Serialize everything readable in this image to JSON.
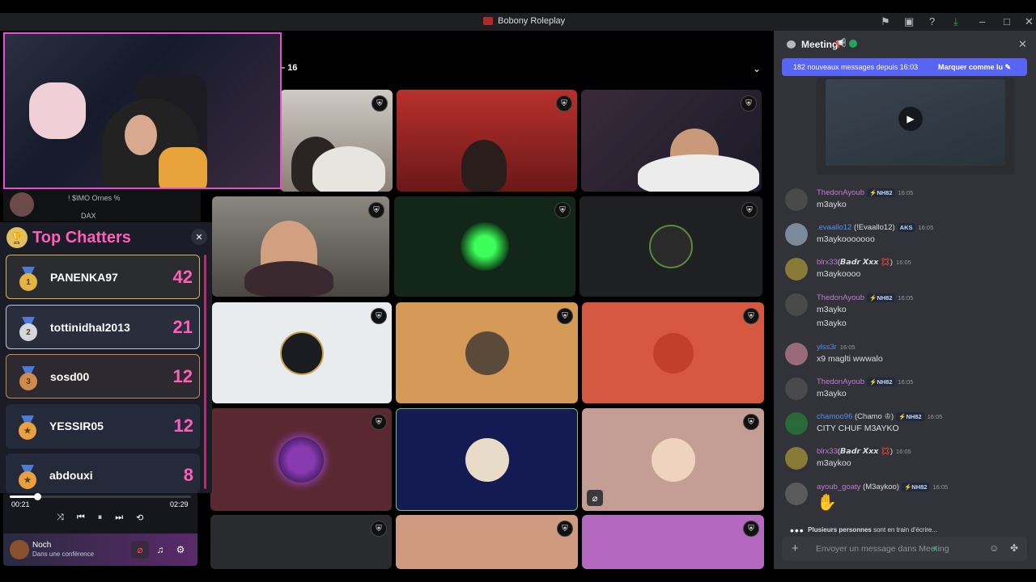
{
  "window": {
    "title": "Bobony Roleplay"
  },
  "stage": {
    "count_label": "16"
  },
  "left": {
    "user_rows": [
      {
        "text": "! $IMO Ornes %"
      },
      {
        "text": "DAX"
      }
    ],
    "top_chatters": {
      "title": "Top Chatters",
      "close": "✕",
      "entries": [
        {
          "rank": "1",
          "name": "PANENKA97",
          "count": "42",
          "coin": "#e3b344",
          "ribbon": "#4c7ad8"
        },
        {
          "rank": "2",
          "name": "tottinidhal2013",
          "count": "21",
          "coin": "#d4d6e0",
          "ribbon": "#4c7ad8"
        },
        {
          "rank": "3",
          "name": "sosd00",
          "count": "12",
          "coin": "#cf8a4e",
          "ribbon": "#4c7ad8"
        },
        {
          "rank": "★",
          "name": "YESSIR05",
          "count": "12",
          "coin": "#e8a040",
          "ribbon": "#4c7ad8"
        },
        {
          "rank": "★",
          "name": "abdouxi",
          "count": "8",
          "coin": "#e8a040",
          "ribbon": "#4c7ad8"
        }
      ]
    },
    "player": {
      "elapsed": "00:21",
      "duration": "02:29",
      "progress": 0.15
    },
    "voice": {
      "name": "Noch",
      "status": "Dans une conférence"
    }
  },
  "chat": {
    "channel": "Meeting",
    "new_messages": "182 nouveaux messages depuis 16:03",
    "mark_read": "Marquer comme lu",
    "messages": [
      {
        "user": "ThedonAyoub",
        "tag": "⚡NH82",
        "time": "16:05",
        "text": "m3ayko",
        "color": "#c27ad6"
      },
      {
        "user": ".evaallo12",
        "extra": "(!Evaallo12)",
        "tag": "AKS",
        "time": "16:05",
        "text": "m3aykooooooo",
        "color": "#5a8cf0"
      },
      {
        "user": "blrx33",
        "extra": "(𝘽𝙖𝙙𝙧 𝙓𝙭𝙭 💢)",
        "time": "16:05",
        "text": "m3aykoooo",
        "color": "#c27ad6"
      },
      {
        "user": "ThedonAyoub",
        "tag": "⚡NH82",
        "time": "16:05",
        "text": "m3ayko",
        "text2": "m3ayko",
        "color": "#c27ad6"
      },
      {
        "user": "ylss3r",
        "time": "16:05",
        "text": "x9 maglti wwwalo",
        "color": "#5a8cf0"
      },
      {
        "user": "ThedonAyoub",
        "tag": "⚡NH82",
        "time": "16:05",
        "text": "m3ayko",
        "color": "#c27ad6"
      },
      {
        "user": "chamoo96",
        "extra": "(Chamo ♔)",
        "tag": "⚡NH82",
        "time": "16:05",
        "text": "CITY CHUF M3AYKO",
        "color": "#5a8cf0"
      },
      {
        "user": "blrx33",
        "extra": "(𝘽𝙖𝙙𝙧 𝙓𝙭𝙭 💢)",
        "time": "16:05",
        "text": "m3aykoo",
        "color": "#c27ad6"
      },
      {
        "user": "ayoub_goaty",
        "extra": "(M3aykoo)",
        "tag": "⚡NH82",
        "time": "16:05",
        "text": "✋",
        "color": "#c27ad6"
      }
    ],
    "typing_bold": "Plusieurs personnes",
    "typing_rest": "sont en train d'écrire...",
    "input_placeholder": "Envoyer un message dans Meeting"
  }
}
